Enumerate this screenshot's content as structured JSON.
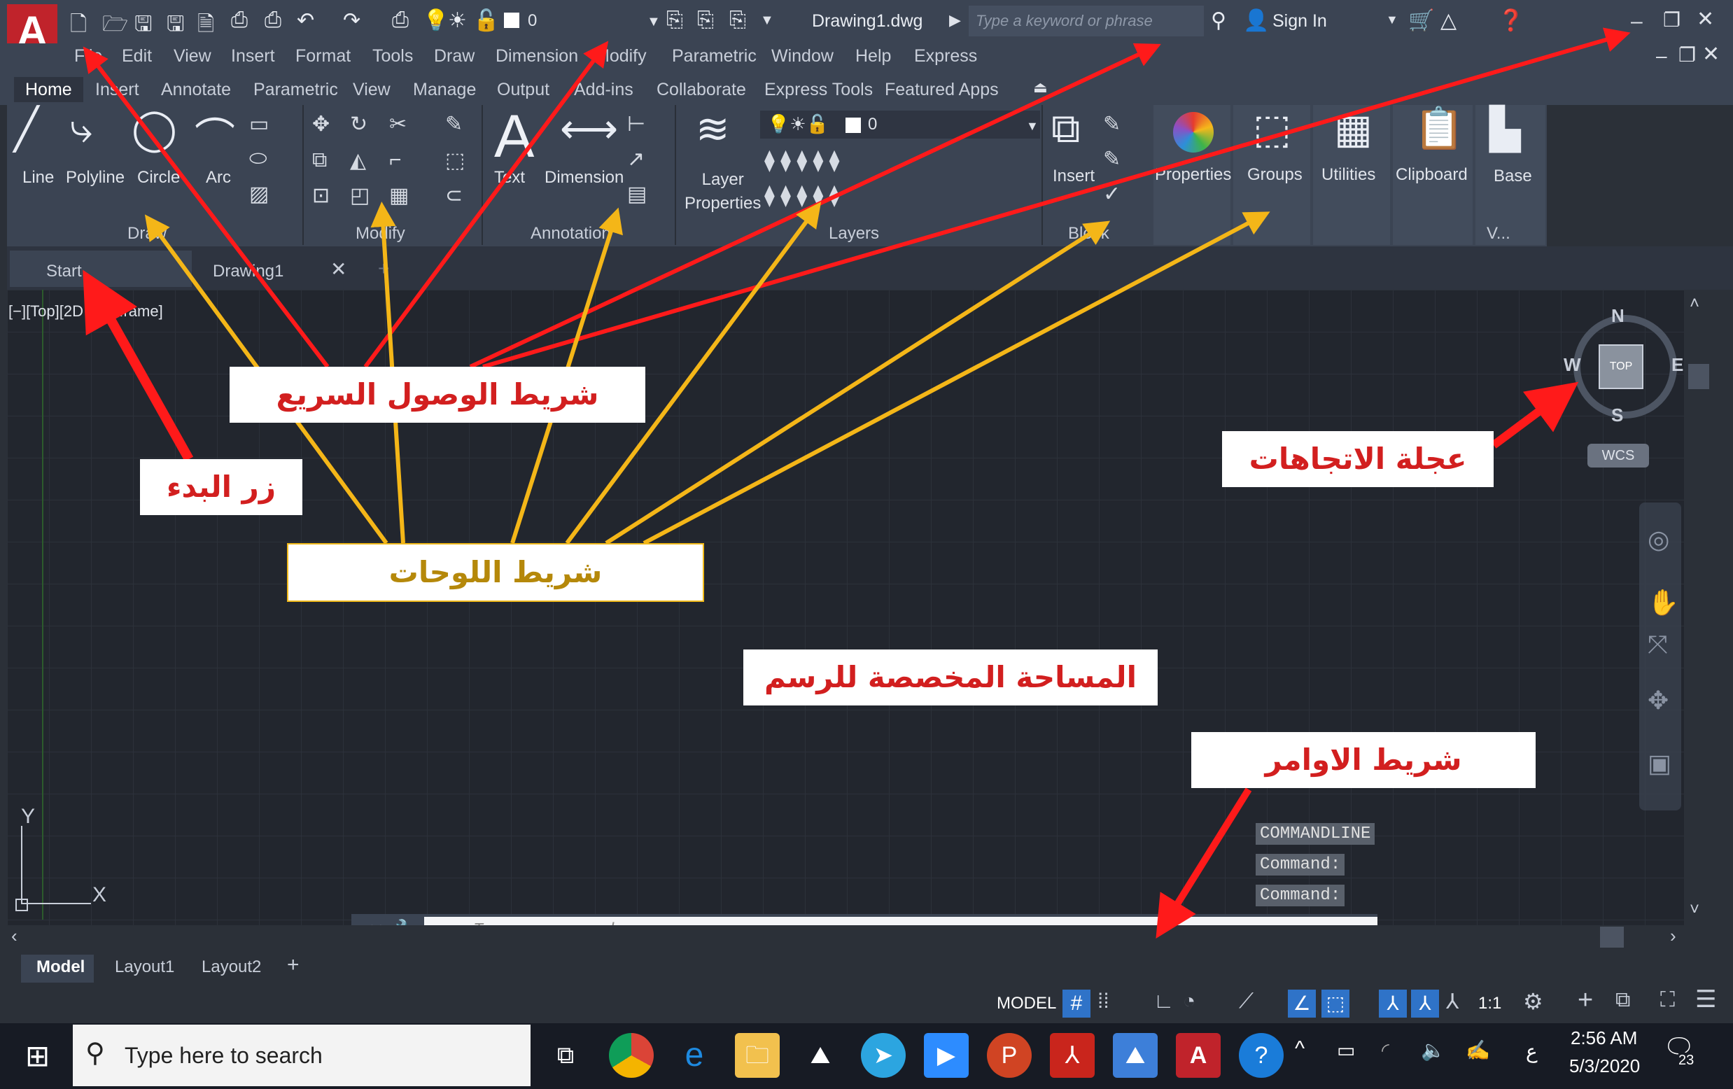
{
  "titlebar": {
    "app_logo": "A",
    "layer_value": "0",
    "filename": "Drawing1.dwg",
    "search_placeholder": "Type a keyword or phrase",
    "sign_in": "Sign In"
  },
  "menu": [
    "File",
    "Edit",
    "View",
    "Insert",
    "Format",
    "Tools",
    "Draw",
    "Dimension",
    "Modify",
    "Parametric",
    "Window",
    "Help",
    "Express"
  ],
  "ribbon_tabs": [
    "Home",
    "Insert",
    "Annotate",
    "Parametric",
    "View",
    "Manage",
    "Output",
    "Add-ins",
    "Collaborate",
    "Express Tools",
    "Featured Apps"
  ],
  "ribbon": {
    "draw_tools": [
      "Line",
      "Polyline",
      "Circle",
      "Arc"
    ],
    "draw_label": "Draw",
    "modify_label": "Modify",
    "annotation_tools": [
      "Text",
      "Dimension"
    ],
    "annotation_label": "Annotation",
    "layer_properties": "Layer\nProperties",
    "layer_value": "0",
    "layers_label": "Layers",
    "insert": "Insert",
    "block_label": "Block",
    "properties": "Properties",
    "groups": "Groups",
    "utilities": "Utilities",
    "clipboard": "Clipboard",
    "base": "Base",
    "view_label": "V..."
  },
  "doc_tabs": {
    "start": "Start",
    "drawing": "Drawing1"
  },
  "viewport_label": "[−][Top][2D Wireframe]",
  "viewcube": {
    "n": "N",
    "s": "S",
    "e": "E",
    "w": "W",
    "top": "TOP",
    "wcs": "WCS"
  },
  "ucs": {
    "x": "X",
    "y": "Y"
  },
  "command": {
    "history": [
      "COMMANDLINE",
      "Command:",
      "Command:"
    ],
    "placeholder": "Type a command"
  },
  "layout_tabs": [
    "Model",
    "Layout1",
    "Layout2"
  ],
  "status": {
    "model": "MODEL",
    "scale": "1:1"
  },
  "taskbar": {
    "search": "Type here to search",
    "time": "2:56 AM",
    "date": "5/3/2020",
    "notif": "23",
    "lang": "ع"
  },
  "annotations": {
    "quick_access": "شريط الوصول السريع",
    "start_button": "زر البدء",
    "panels_bar": "شريط اللوحات",
    "drawing_area": "المساحة المخصصة للرسم",
    "command_bar": "شريط الاوامر",
    "viewcube": "عجلة الاتجاهات"
  },
  "colors": {
    "red_arrow": "#ff1a1a",
    "yellow_arrow": "#f4b618",
    "accent": "#c0232b"
  }
}
